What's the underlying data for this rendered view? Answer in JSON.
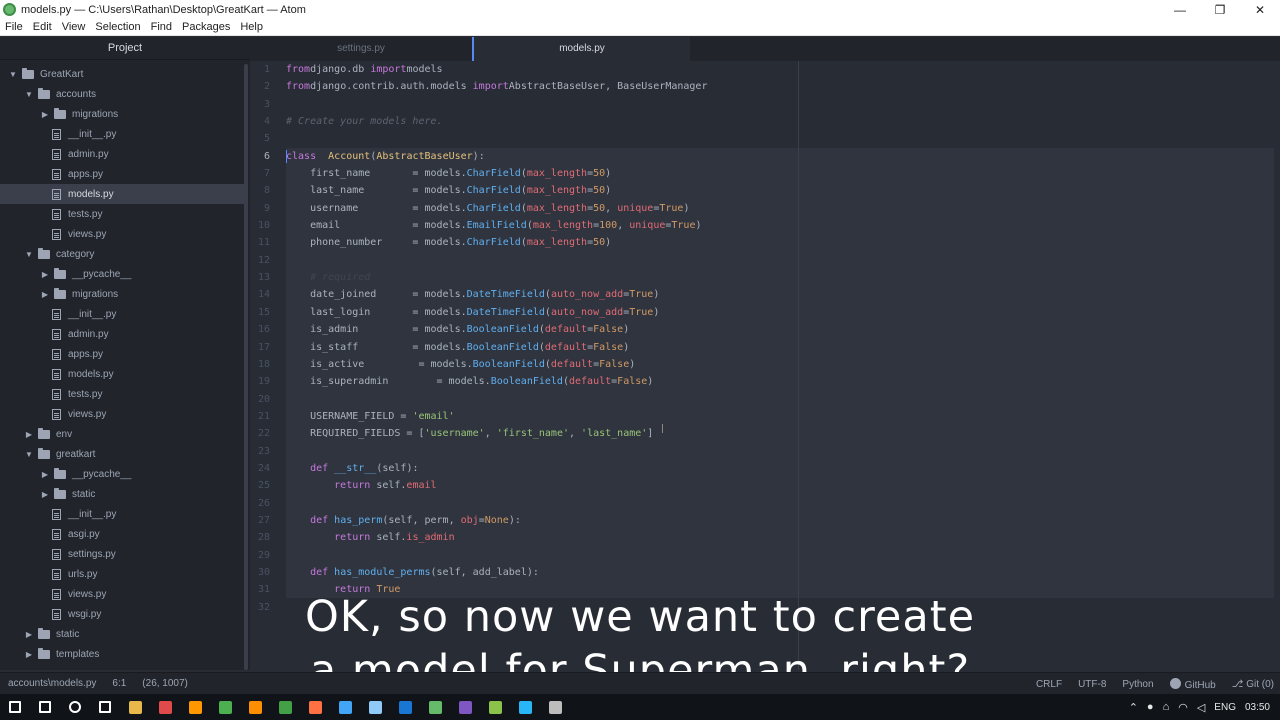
{
  "window": {
    "title": "models.py — C:\\Users\\Rathan\\Desktop\\GreatKart — Atom",
    "controls": [
      "—",
      "❐",
      "✕"
    ]
  },
  "menu": [
    "File",
    "Edit",
    "View",
    "Selection",
    "Find",
    "Packages",
    "Help"
  ],
  "sidebar": {
    "header": "Project",
    "tree": [
      {
        "label": "GreatKart",
        "type": "folder",
        "depth": 0,
        "expanded": true
      },
      {
        "label": "accounts",
        "type": "folder",
        "depth": 1,
        "expanded": true
      },
      {
        "label": "migrations",
        "type": "folder",
        "depth": 2,
        "expanded": false
      },
      {
        "label": "__init__.py",
        "type": "file",
        "depth": 2
      },
      {
        "label": "admin.py",
        "type": "file",
        "depth": 2
      },
      {
        "label": "apps.py",
        "type": "file",
        "depth": 2
      },
      {
        "label": "models.py",
        "type": "file",
        "depth": 2,
        "selected": true
      },
      {
        "label": "tests.py",
        "type": "file",
        "depth": 2
      },
      {
        "label": "views.py",
        "type": "file",
        "depth": 2
      },
      {
        "label": "category",
        "type": "folder",
        "depth": 1,
        "expanded": true
      },
      {
        "label": "__pycache__",
        "type": "folder",
        "depth": 2,
        "expanded": false
      },
      {
        "label": "migrations",
        "type": "folder",
        "depth": 2,
        "expanded": false
      },
      {
        "label": "__init__.py",
        "type": "file",
        "depth": 2
      },
      {
        "label": "admin.py",
        "type": "file",
        "depth": 2
      },
      {
        "label": "apps.py",
        "type": "file",
        "depth": 2
      },
      {
        "label": "models.py",
        "type": "file",
        "depth": 2
      },
      {
        "label": "tests.py",
        "type": "file",
        "depth": 2
      },
      {
        "label": "views.py",
        "type": "file",
        "depth": 2
      },
      {
        "label": "env",
        "type": "folder",
        "depth": 1,
        "expanded": false
      },
      {
        "label": "greatkart",
        "type": "folder",
        "depth": 1,
        "expanded": true
      },
      {
        "label": "__pycache__",
        "type": "folder",
        "depth": 2,
        "expanded": false
      },
      {
        "label": "static",
        "type": "folder",
        "depth": 2,
        "expanded": false
      },
      {
        "label": "__init__.py",
        "type": "file",
        "depth": 2
      },
      {
        "label": "asgi.py",
        "type": "file",
        "depth": 2
      },
      {
        "label": "settings.py",
        "type": "file",
        "depth": 2
      },
      {
        "label": "urls.py",
        "type": "file",
        "depth": 2
      },
      {
        "label": "views.py",
        "type": "file",
        "depth": 2
      },
      {
        "label": "wsgi.py",
        "type": "file",
        "depth": 2
      },
      {
        "label": "static",
        "type": "folder",
        "depth": 1,
        "expanded": false
      },
      {
        "label": "templates",
        "type": "folder",
        "depth": 1,
        "expanded": false
      }
    ]
  },
  "tabs": [
    {
      "label": "settings.py",
      "active": false
    },
    {
      "label": "models.py",
      "active": true
    }
  ],
  "editor": {
    "cursor_line": 6,
    "lines": [
      [
        [
          "kw",
          "from"
        ],
        [
          "",
          "django.db "
        ],
        [
          "kw",
          "import"
        ],
        [
          "",
          "models"
        ]
      ],
      [
        [
          "kw",
          "from"
        ],
        [
          "",
          "django.contrib.auth.models "
        ],
        [
          "kw",
          "import"
        ],
        [
          "",
          "AbstractBaseUser, BaseUserManager"
        ]
      ],
      [],
      [
        [
          "cmt",
          "# Create your models here."
        ]
      ],
      [],
      [
        [
          "kw",
          "class"
        ],
        [
          "",
          "  "
        ],
        [
          "cls",
          "Account"
        ],
        [
          "punc",
          "("
        ],
        [
          "cls",
          "AbstractBaseUser"
        ],
        [
          "punc",
          "):"
        ]
      ],
      [
        [
          "",
          "    first_name       = models."
        ],
        [
          "fn",
          "CharField"
        ],
        [
          "punc",
          "("
        ],
        [
          "prop",
          "max_length"
        ],
        [
          "punc",
          "="
        ],
        [
          "num",
          "50"
        ],
        [
          "punc",
          ")"
        ]
      ],
      [
        [
          "",
          "    last_name        = models."
        ],
        [
          "fn",
          "CharField"
        ],
        [
          "punc",
          "("
        ],
        [
          "prop",
          "max_length"
        ],
        [
          "punc",
          "="
        ],
        [
          "num",
          "50"
        ],
        [
          "punc",
          ")"
        ]
      ],
      [
        [
          "",
          "    username         = models."
        ],
        [
          "fn",
          "CharField"
        ],
        [
          "punc",
          "("
        ],
        [
          "prop",
          "max_length"
        ],
        [
          "punc",
          "="
        ],
        [
          "num",
          "50"
        ],
        [
          "punc",
          ", "
        ],
        [
          "prop",
          "unique"
        ],
        [
          "punc",
          "="
        ],
        [
          "num",
          "True"
        ],
        [
          "punc",
          ")"
        ]
      ],
      [
        [
          "",
          "    email            = models."
        ],
        [
          "fn",
          "EmailField"
        ],
        [
          "punc",
          "("
        ],
        [
          "prop",
          "max_length"
        ],
        [
          "punc",
          "="
        ],
        [
          "num",
          "100"
        ],
        [
          "punc",
          ", "
        ],
        [
          "prop",
          "unique"
        ],
        [
          "punc",
          "="
        ],
        [
          "num",
          "True"
        ],
        [
          "punc",
          ")"
        ]
      ],
      [
        [
          "",
          "    phone_number     = models."
        ],
        [
          "fn",
          "CharField"
        ],
        [
          "punc",
          "("
        ],
        [
          "prop",
          "max_length"
        ],
        [
          "punc",
          "="
        ],
        [
          "num",
          "50"
        ],
        [
          "punc",
          ")"
        ]
      ],
      [],
      [
        [
          "faint",
          "    # required"
        ]
      ],
      [
        [
          "",
          "    date_joined      = models."
        ],
        [
          "fn",
          "DateTimeField"
        ],
        [
          "punc",
          "("
        ],
        [
          "prop",
          "auto_now_add"
        ],
        [
          "punc",
          "="
        ],
        [
          "num",
          "True"
        ],
        [
          "punc",
          ")"
        ]
      ],
      [
        [
          "",
          "    last_login       = models."
        ],
        [
          "fn",
          "DateTimeField"
        ],
        [
          "punc",
          "("
        ],
        [
          "prop",
          "auto_now_add"
        ],
        [
          "punc",
          "="
        ],
        [
          "num",
          "True"
        ],
        [
          "punc",
          ")"
        ]
      ],
      [
        [
          "",
          "    is_admin         = models."
        ],
        [
          "fn",
          "BooleanField"
        ],
        [
          "punc",
          "("
        ],
        [
          "prop",
          "default"
        ],
        [
          "punc",
          "="
        ],
        [
          "num",
          "False"
        ],
        [
          "punc",
          ")"
        ]
      ],
      [
        [
          "",
          "    is_staff         = models."
        ],
        [
          "fn",
          "BooleanField"
        ],
        [
          "punc",
          "("
        ],
        [
          "prop",
          "default"
        ],
        [
          "punc",
          "="
        ],
        [
          "num",
          "False"
        ],
        [
          "punc",
          ")"
        ]
      ],
      [
        [
          "",
          "    is_active         = models."
        ],
        [
          "fn",
          "BooleanField"
        ],
        [
          "punc",
          "("
        ],
        [
          "prop",
          "default"
        ],
        [
          "punc",
          "="
        ],
        [
          "num",
          "False"
        ],
        [
          "punc",
          ")"
        ]
      ],
      [
        [
          "",
          "    is_superadmin        = models."
        ],
        [
          "fn",
          "BooleanField"
        ],
        [
          "punc",
          "("
        ],
        [
          "prop",
          "default"
        ],
        [
          "punc",
          "="
        ],
        [
          "num",
          "False"
        ],
        [
          "punc",
          ")"
        ]
      ],
      [],
      [
        [
          "",
          "    USERNAME_FIELD = "
        ],
        [
          "str",
          "'email'"
        ]
      ],
      [
        [
          "",
          "    REQUIRED_FIELDS = ["
        ],
        [
          "str",
          "'username'"
        ],
        [
          "punc",
          ", "
        ],
        [
          "str",
          "'first_name'"
        ],
        [
          "punc",
          ", "
        ],
        [
          "str",
          "'last_name'"
        ],
        [
          "punc",
          "]"
        ]
      ],
      [],
      [
        [
          "kw",
          "    def "
        ],
        [
          "fn",
          "__str__"
        ],
        [
          "punc",
          "("
        ],
        [
          "",
          "self"
        ],
        [
          "punc",
          "):"
        ]
      ],
      [
        [
          "kw",
          "        return "
        ],
        [
          "",
          "self."
        ],
        [
          "prop",
          "email"
        ]
      ],
      [],
      [
        [
          "kw",
          "    def "
        ],
        [
          "fn",
          "has_perm"
        ],
        [
          "punc",
          "("
        ],
        [
          "",
          "self, perm, "
        ],
        [
          "prop",
          "obj"
        ],
        [
          "punc",
          "="
        ],
        [
          "num",
          "None"
        ],
        [
          "punc",
          "):"
        ]
      ],
      [
        [
          "kw",
          "        return "
        ],
        [
          "",
          "self."
        ],
        [
          "prop",
          "is_admin"
        ]
      ],
      [],
      [
        [
          "kw",
          "    def "
        ],
        [
          "fn",
          "has_module_perms"
        ],
        [
          "punc",
          "("
        ],
        [
          "",
          "self, add_label"
        ],
        [
          "punc",
          "):"
        ]
      ],
      [
        [
          "kw",
          "        return "
        ],
        [
          "num",
          "True"
        ]
      ],
      []
    ]
  },
  "caption": {
    "line1": "OK, so now we want to create",
    "line2": "a model for Superman, right?"
  },
  "statusbar": {
    "path": "accounts\\models.py",
    "position": "6:1",
    "selection": "(26, 1007)",
    "line_ending": "CRLF",
    "encoding": "UTF-8",
    "grammar": "Python",
    "github": "GitHub",
    "git": "Git (0)"
  },
  "taskbar": {
    "apps": [
      "start-icon",
      "search-icon",
      "cortana-icon",
      "taskview-icon",
      "explorer-icon",
      "snip-icon",
      "sublime-icon",
      "chrome-icon",
      "app-icon",
      "terminal-icon",
      "firefox-icon",
      "vscode-icon",
      "remote-icon",
      "book-icon",
      "atom-icon",
      "app2-icon",
      "app3-icon",
      "app4-icon",
      "obs-icon"
    ],
    "app_colors": [
      "#ffffff",
      "#ffffff",
      "#ffffff",
      "#ffffff",
      "#e8b94a",
      "#e04a4a",
      "#ff9800",
      "#4caf50",
      "#ff8f00",
      "#43a047",
      "#ff7043",
      "#42a5f5",
      "#90caf9",
      "#1976d2",
      "#66bb6a",
      "#7e57c2",
      "#8bc34a",
      "#29b6f6",
      "#bdbdbd"
    ],
    "language": "ENG",
    "time": "03:50"
  }
}
